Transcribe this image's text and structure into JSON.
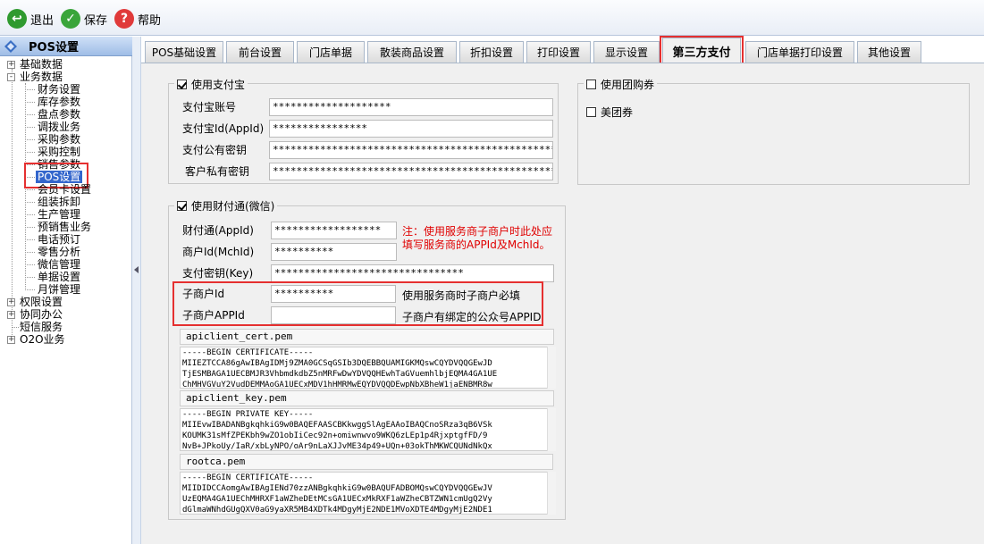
{
  "toolbar": {
    "exit_label": "退出",
    "save_label": "保存",
    "help_label": "帮助"
  },
  "left_panel": {
    "title": "POS设置",
    "items": [
      {
        "label": "基础数据",
        "expander": "+"
      },
      {
        "label": "业务数据",
        "expander": "-"
      },
      {
        "label": "财务设置"
      },
      {
        "label": "库存参数"
      },
      {
        "label": "盘点参数"
      },
      {
        "label": "调拨业务"
      },
      {
        "label": "采购参数"
      },
      {
        "label": "采购控制"
      },
      {
        "label": "销售参数"
      },
      {
        "label": "POS设置"
      },
      {
        "label": "会员卡设置"
      },
      {
        "label": "组装拆卸"
      },
      {
        "label": "生产管理"
      },
      {
        "label": "预销售业务"
      },
      {
        "label": "电话预订"
      },
      {
        "label": "零售分析"
      },
      {
        "label": "微信管理"
      },
      {
        "label": "单据设置"
      },
      {
        "label": "月饼管理"
      },
      {
        "label": "权限设置",
        "expander": "+"
      },
      {
        "label": "协同办公",
        "expander": "+"
      },
      {
        "label": "短信服务"
      },
      {
        "label": "O2O业务",
        "expander": "+"
      }
    ]
  },
  "tabs": [
    {
      "label": "POS基础设置"
    },
    {
      "label": "前台设置"
    },
    {
      "label": "门店单据"
    },
    {
      "label": "散装商品设置"
    },
    {
      "label": "折扣设置"
    },
    {
      "label": "打印设置"
    },
    {
      "label": "显示设置"
    },
    {
      "label": "第三方支付"
    },
    {
      "label": "门店单据打印设置"
    },
    {
      "label": "其他设置"
    }
  ],
  "alipay": {
    "title": "使用支付宝",
    "checked": true,
    "fields": [
      {
        "label": "支付宝账号",
        "value": "********************"
      },
      {
        "label": "支付宝Id(AppId)",
        "value": "****************"
      },
      {
        "label": "支付公有密钥",
        "value": "**************************************************"
      },
      {
        "label": "客户私有密钥",
        "value": "**************************************************"
      }
    ]
  },
  "groupbuy": {
    "title": "使用团购券",
    "checked": false,
    "meituan_label": "美团券",
    "meituan_checked": false
  },
  "wechat": {
    "title": "使用财付通(微信)",
    "checked": true,
    "appid_label": "财付通(AppId)",
    "appid_value": "******************",
    "mchid_label": "商户Id(MchId)",
    "mchid_value": "**********",
    "key_label": "支付密钥(Key)",
    "key_value": "********************************",
    "note": "注：使用服务商子商户时此处应填写服务商的APPId及MchId。",
    "sub_mchid_label": "子商户Id",
    "sub_mchid_value": "**********",
    "sub_mchid_hint": "使用服务商时子商户必填",
    "sub_appid_label": "子商户APPId",
    "sub_appid_value": "",
    "sub_appid_hint": "子商户有绑定的公众号APPID",
    "cert_file": "apiclient_cert.pem",
    "cert_text": "-----BEGIN CERTIFICATE-----\nMIIEZTCCA86gAwIBAgIDMj9ZMA0GCSqGSIb3DQEBBQUAMIGKMQswCQYDVQQGEwJD\nTjESMBAGA1UECBMJR3VhbmdkdbZ5nMRFwDwYDVQQHEwhTaGVuemhlbjEQMA4GA1UE\nChMHVGVuY2VudDEMMAoGA1UECxMDV1hHMRMwEQYDVQQDEwpNbXBheW1jaENBMR8w",
    "key_file": "apiclient_key.pem",
    "key_text": "-----BEGIN PRIVATE KEY-----\nMIIEvwIBADANBgkqhkiG9w0BAQEFAASCBKkwggSlAgEAAoIBAQCnoSRza3qB6VSk\nKOUMK31sMfZPEKbh9wZO1obIiCec92n+omiwnwvo9WKQ6zLEp1p4RjxptgfFD/9\nNvB+JPkoUy/IaR/xbLyNPO/oAr9nLaXJJvME34p49+UQn+03okThMKWCQUNdNkQx",
    "ca_file": "rootca.pem",
    "ca_text": "-----BEGIN CERTIFICATE-----\nMIIDIDCCAomgAwIBAgIENd70zzANBgkqhkiG9w0BAQUFADBOMQswCQYDVQQGEwJV\nUzEQMA4GA1UEChMHRXF1aWZheDEtMCsGA1UECxMkRXF1aWZheCBTZWN1cmUgQ2Vy\ndGlmaWNhdGUgQXV0aG9yaXR5MB4XDTk4MDgyMjE2NDE1MVoXDTE4MDgyMjE2NDE1"
  }
}
